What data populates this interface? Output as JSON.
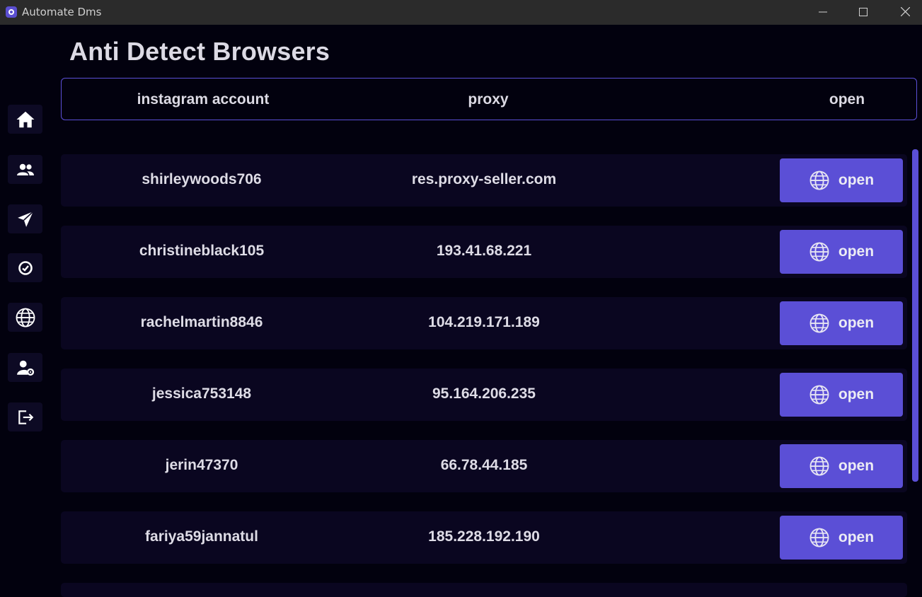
{
  "window": {
    "title": "Automate Dms"
  },
  "sidebar": {
    "items": [
      {
        "name": "home",
        "icon": "home-icon"
      },
      {
        "name": "accounts",
        "icon": "users-icon"
      },
      {
        "name": "send",
        "icon": "send-icon"
      },
      {
        "name": "tasks",
        "icon": "check-circle-icon"
      },
      {
        "name": "browsers",
        "icon": "globe-icon"
      },
      {
        "name": "account-settings",
        "icon": "user-gear-icon"
      },
      {
        "name": "logout",
        "icon": "logout-icon"
      }
    ]
  },
  "page": {
    "title": "Anti Detect Browsers"
  },
  "table": {
    "headers": {
      "account": "instagram account",
      "proxy": "proxy",
      "open": "open"
    },
    "rows": [
      {
        "account": "shirleywoods706",
        "proxy": "res.proxy-seller.com",
        "action": "open"
      },
      {
        "account": "christineblack105",
        "proxy": "193.41.68.221",
        "action": "open"
      },
      {
        "account": "rachelmartin8846",
        "proxy": "104.219.171.189",
        "action": "open"
      },
      {
        "account": "jessica753148",
        "proxy": "95.164.206.235",
        "action": "open"
      },
      {
        "account": "jerin47370",
        "proxy": "66.78.44.185",
        "action": "open"
      },
      {
        "account": "fariya59jannatul",
        "proxy": "185.228.192.190",
        "action": "open"
      }
    ]
  },
  "colors": {
    "accent": "#5b4fd6",
    "background": "#02010e",
    "row": "#0a0620"
  }
}
